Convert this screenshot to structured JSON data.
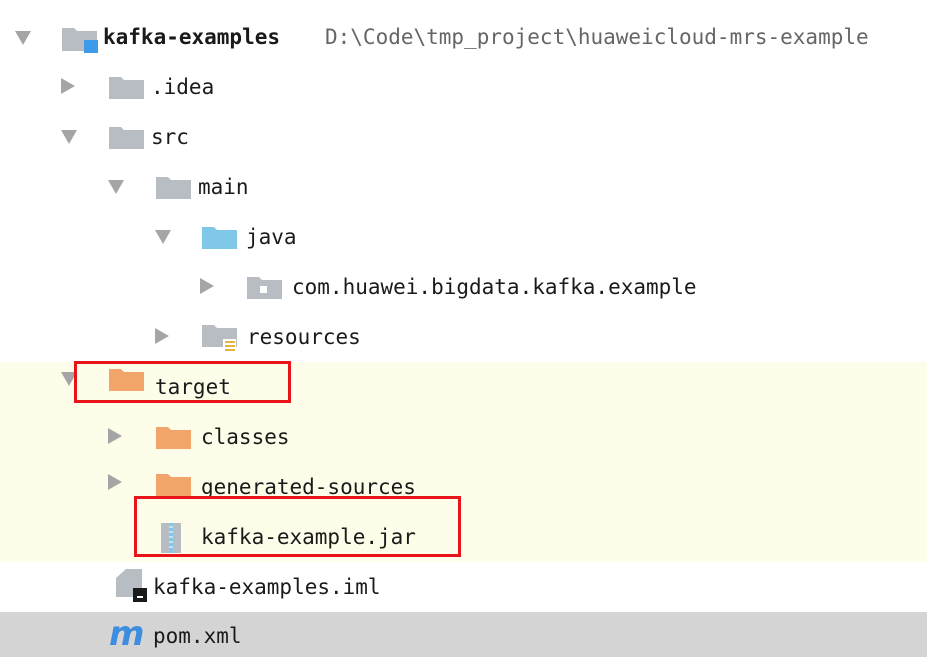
{
  "project": {
    "name": "kafka-examples",
    "path": "D:\\Code\\tmp_project\\huaweicloud-mrs-example"
  },
  "tree": {
    "idea": ".idea",
    "src": "src",
    "main": "main",
    "java": "java",
    "package": "com.huawei.bigdata.kafka.example",
    "resources": "resources",
    "target": "target",
    "classes": "classes",
    "generated_sources": "generated-sources",
    "jar": "kafka-example.jar",
    "iml": "kafka-examples.iml",
    "pom": "pom.xml"
  },
  "icons": {
    "folder_gray": "#b8bdc3",
    "folder_blue": "#7fc8ea",
    "folder_orange": "#f2a56b",
    "module_blue": "#3d9be9",
    "maven_m": "#3d8de0"
  },
  "highlights": {
    "target_row": "#fdfde9",
    "selected_row": "#d4d4d4",
    "callout": "#e8141a"
  }
}
